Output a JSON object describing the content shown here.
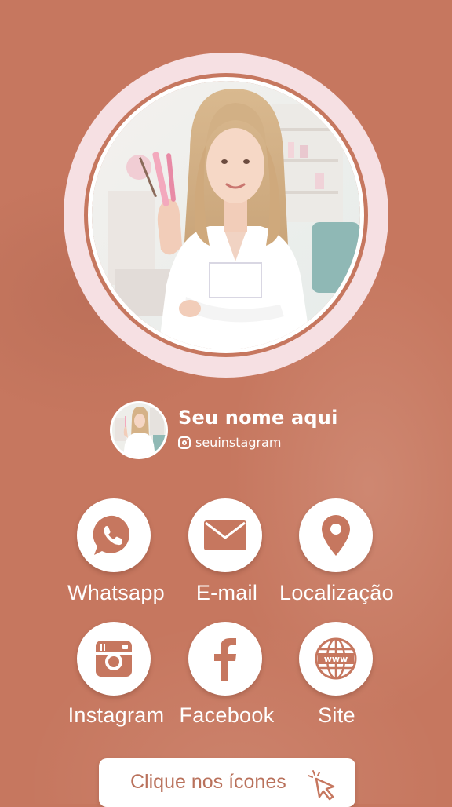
{
  "profile": {
    "name": "Seu nome aqui",
    "handle": "seuinstagram"
  },
  "links": [
    {
      "label": "Whatsapp",
      "icon": "whatsapp-icon"
    },
    {
      "label": "E-mail",
      "icon": "mail-icon"
    },
    {
      "label": "Localização",
      "icon": "location-pin-icon"
    },
    {
      "label": "Instagram",
      "icon": "instagram-icon"
    },
    {
      "label": "Facebook",
      "icon": "facebook-icon"
    },
    {
      "label": "Site",
      "icon": "globe-www-icon"
    }
  ],
  "cta": {
    "label": "Clique nos ícones",
    "icon": "cursor-click-icon"
  },
  "colors": {
    "background": "#c6775f",
    "ring": "#f6e0e3",
    "icon": "#c6775f",
    "text": "#ffffff",
    "cta_text": "#b9715b"
  }
}
